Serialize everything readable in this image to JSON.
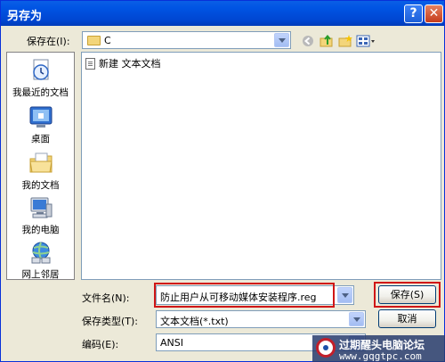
{
  "dialog": {
    "title": "另存为",
    "help_glyph": "?",
    "close_glyph": "✕"
  },
  "location": {
    "label": "保存在(I):",
    "value": "C"
  },
  "toolbar_icons": [
    "back-icon",
    "up-folder-icon",
    "new-folder-icon",
    "view-menu-icon"
  ],
  "places": [
    {
      "label": "我最近的文档",
      "icon": "recent-documents-icon"
    },
    {
      "label": "桌面",
      "icon": "desktop-icon"
    },
    {
      "label": "我的文档",
      "icon": "my-documents-icon"
    },
    {
      "label": "我的电脑",
      "icon": "my-computer-icon"
    },
    {
      "label": "网上邻居",
      "icon": "network-places-icon"
    }
  ],
  "files": [
    {
      "name": "新建 文本文档",
      "icon": "text-file-icon"
    }
  ],
  "filename": {
    "label": "文件名(N):",
    "value": "防止用户从可移动媒体安装程序.reg"
  },
  "filetype": {
    "label": "保存类型(T):",
    "value": "文本文档(*.txt)"
  },
  "encoding": {
    "label": "编码(E):",
    "value": "ANSI"
  },
  "buttons": {
    "save": "保存(S)",
    "cancel_partial": "取消"
  },
  "watermark": {
    "text": "过期醒头电脑论坛",
    "url": "www.gqgtpc.com"
  },
  "colors": {
    "title_bar": "#0054e3",
    "highlight_box": "#d01616"
  }
}
